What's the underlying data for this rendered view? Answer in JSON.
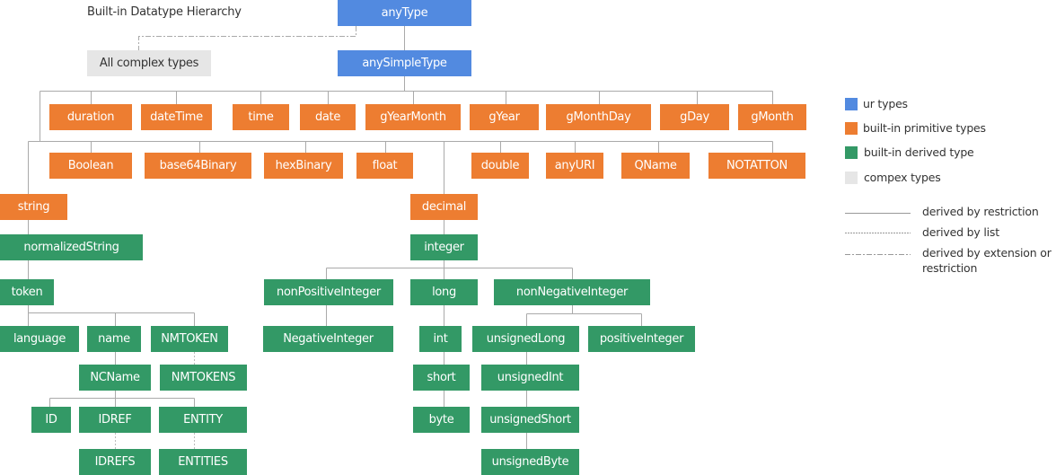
{
  "title": "Built-in Datatype Hierarchy",
  "colors": {
    "ur": "#528ae0",
    "primitive": "#ed7d31",
    "derived": "#339966",
    "complex": "#e6e6e6",
    "line": "#aaaaaa"
  },
  "nodes": {
    "anyType": "anyType",
    "allComplex": "All complex types",
    "anySimpleType": "anySimpleType",
    "duration": "duration",
    "dateTime": "dateTime",
    "time": "time",
    "date": "date",
    "gYearMonth": "gYearMonth",
    "gYear": "gYear",
    "gMonthDay": "gMonthDay",
    "gDay": "gDay",
    "gMonth": "gMonth",
    "Boolean": "Boolean",
    "base64Binary": "base64Binary",
    "hexBinary": "hexBinary",
    "float": "float",
    "double": "double",
    "anyURI": "anyURI",
    "QName": "QName",
    "NOTATTON": "NOTATTON",
    "string": "string",
    "decimal": "decimal",
    "normalizedString": "normalizedString",
    "integer": "integer",
    "token": "token",
    "nonPositiveInteger": "nonPositiveInteger",
    "long": "long",
    "nonNegativeInteger": "nonNegativeInteger",
    "language": "language",
    "name": "name",
    "NMTOKEN": "NMTOKEN",
    "NegativeInteger": "NegativeInteger",
    "int": "int",
    "unsignedLong": "unsignedLong",
    "positiveInteger": "positiveInteger",
    "NCName": "NCName",
    "NMTOKENS": "NMTOKENS",
    "short": "short",
    "unsignedInt": "unsignedInt",
    "ID": "ID",
    "IDREF": "IDREF",
    "ENTITY": "ENTITY",
    "byte": "byte",
    "unsignedShort": "unsignedShort",
    "IDREFS": "IDREFS",
    "ENTITIES": "ENTITIES",
    "unsignedByte": "unsignedByte"
  },
  "legend": {
    "items": [
      {
        "label": "ur types",
        "kind": "ur"
      },
      {
        "label": "built-in primitive types",
        "kind": "primitive"
      },
      {
        "label": "built-in derived type",
        "kind": "derived"
      },
      {
        "label": "compex types",
        "kind": "complex"
      }
    ],
    "lines": [
      {
        "label": "derived by restriction",
        "style": "solid"
      },
      {
        "label": "derived by list",
        "style": "dotted"
      },
      {
        "label": "derived by extension or restriction",
        "style": "dash-dot"
      }
    ]
  }
}
